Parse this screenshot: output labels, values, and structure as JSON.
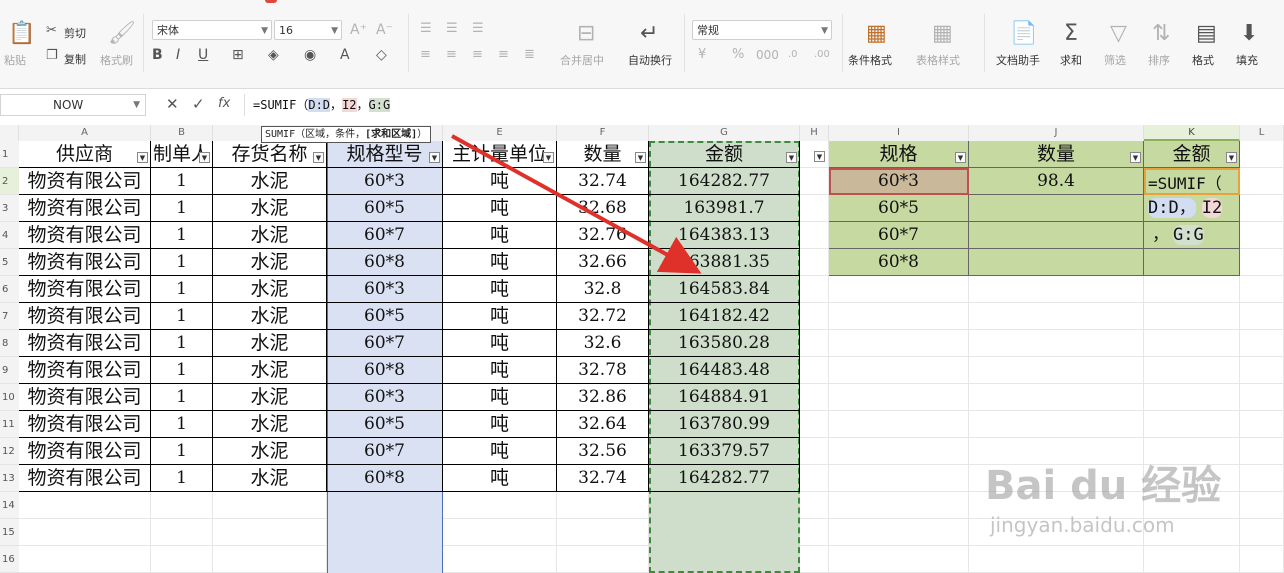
{
  "ribbon": {
    "clipboard": {
      "paste": "粘贴",
      "cut": "剪切",
      "copy": "复制",
      "format_painter": "格式刷"
    },
    "font": {
      "name": "宋体",
      "size": "16"
    },
    "alignment": {
      "merge_center": "合并居中",
      "wrap_text": "自动换行"
    },
    "number": {
      "format": "常规"
    },
    "styles": {
      "conditional_format": "条件格式",
      "table_style": "表格样式"
    },
    "tools": {
      "doc_assistant": "文档助手",
      "sum": "求和",
      "filter": "筛选",
      "sort": "排序",
      "format": "格式",
      "fill": "填充"
    }
  },
  "formula_bar": {
    "name_box": "NOW",
    "formula_prefix": "=SUMIF（",
    "ref1": "D:D",
    "sep1": "，",
    "ref2": "I2",
    "sep2": "，",
    "ref3": "G:G",
    "tooltip_prefix": "SUMIF（区域，条件，",
    "tooltip_bold": "[求和区域]",
    "tooltip_suffix": "）"
  },
  "grid": {
    "columns": [
      "A",
      "B",
      "C",
      "D",
      "E",
      "F",
      "G",
      "H",
      "I",
      "J",
      "K",
      "L"
    ],
    "rows": [
      "1",
      "2",
      "3",
      "4",
      "5",
      "6",
      "7",
      "8",
      "9",
      "10",
      "11",
      "12",
      "13",
      "14",
      "15",
      "16"
    ],
    "headers": [
      "供应商",
      "制单人",
      "存货名称",
      "规格型号",
      "主计量单位",
      "数量",
      "金额"
    ],
    "data": [
      [
        "物资有限公司",
        "1",
        "水泥",
        "60*3",
        "吨",
        "32.74",
        "164282.77"
      ],
      [
        "物资有限公司",
        "1",
        "水泥",
        "60*5",
        "吨",
        "32.68",
        "163981.7"
      ],
      [
        "物资有限公司",
        "1",
        "水泥",
        "60*7",
        "吨",
        "32.76",
        "164383.13"
      ],
      [
        "物资有限公司",
        "1",
        "水泥",
        "60*8",
        "吨",
        "32.66",
        "163881.35"
      ],
      [
        "物资有限公司",
        "1",
        "水泥",
        "60*3",
        "吨",
        "32.8",
        "164583.84"
      ],
      [
        "物资有限公司",
        "1",
        "水泥",
        "60*5",
        "吨",
        "32.72",
        "164182.42"
      ],
      [
        "物资有限公司",
        "1",
        "水泥",
        "60*7",
        "吨",
        "32.6",
        "163580.28"
      ],
      [
        "物资有限公司",
        "1",
        "水泥",
        "60*8",
        "吨",
        "32.78",
        "164483.48"
      ],
      [
        "物资有限公司",
        "1",
        "水泥",
        "60*3",
        "吨",
        "32.86",
        "164884.91"
      ],
      [
        "物资有限公司",
        "1",
        "水泥",
        "60*5",
        "吨",
        "32.64",
        "163780.99"
      ],
      [
        "物资有限公司",
        "1",
        "水泥",
        "60*7",
        "吨",
        "32.56",
        "163379.57"
      ],
      [
        "物资有限公司",
        "1",
        "水泥",
        "60*8",
        "吨",
        "32.74",
        "164282.77"
      ]
    ],
    "summary_headers": [
      "规格",
      "数量",
      "金额"
    ],
    "summary_specs": [
      "60*3",
      "60*5",
      "60*7",
      "60*8"
    ],
    "summary_qty": [
      "98.4",
      "",
      "",
      ""
    ],
    "summary_formula_lines": [
      "=SUMIF（",
      "D:D，",
      "I2",
      "，",
      "G:G"
    ]
  },
  "watermark": {
    "line1": "Bai du 经验",
    "line2": "jingyan.baidu.com"
  },
  "colors": {
    "selected_col_blue": "#d9e1f2",
    "selected_col_green": "#cfddcb",
    "summary_green": "#c6d9a0",
    "arrow": "#e0302a"
  }
}
